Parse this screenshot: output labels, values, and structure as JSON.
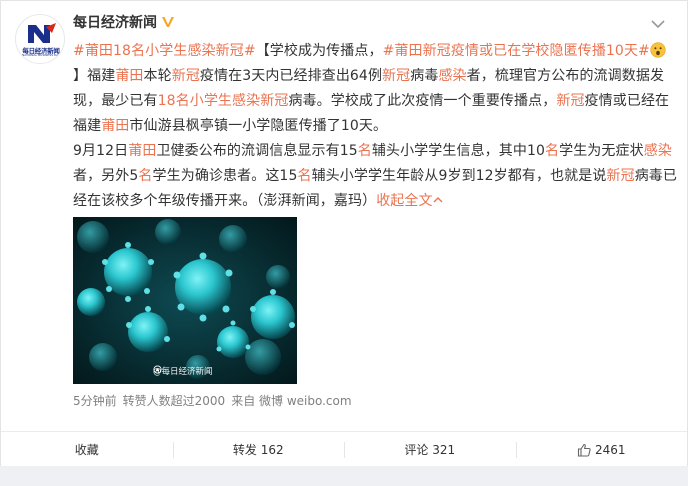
{
  "account": {
    "name": "每日经济新闻",
    "avatar_caption": "每日经济新闻",
    "avatar_sub": "NATIONAL BUSINESS DAILY"
  },
  "post": {
    "lines": [
      [
        {
          "t": "#莆田18名小学生感染新冠#",
          "c": "tag"
        },
        {
          "t": "【学校成为传播点，",
          "c": "grey"
        },
        {
          "t": "#莆田新冠疫情或已在学校隐匿传播10天#",
          "c": "tag"
        },
        {
          "t": "",
          "c": "emoji"
        }
      ],
      [
        {
          "t": "】福建",
          "c": "grey"
        },
        {
          "t": "莆田",
          "c": "hl"
        },
        {
          "t": "本轮",
          "c": "grey"
        },
        {
          "t": "新冠",
          "c": "hl"
        },
        {
          "t": "疫情在3天内已经排查出64例",
          "c": "grey"
        },
        {
          "t": "新冠",
          "c": "hl"
        },
        {
          "t": "病毒",
          "c": "grey"
        },
        {
          "t": "感染",
          "c": "hl"
        },
        {
          "t": "者，梳理官方公布的流调数据发",
          "c": "grey"
        }
      ],
      [
        {
          "t": "现，最少已有",
          "c": "grey"
        },
        {
          "t": "18名小学生感染新冠",
          "c": "hl"
        },
        {
          "t": "病毒。学校成了此次疫情一个重要传播点，",
          "c": "grey"
        },
        {
          "t": "新冠",
          "c": "hl"
        },
        {
          "t": "疫情或已经在",
          "c": "grey"
        }
      ],
      [
        {
          "t": "福建",
          "c": "grey"
        },
        {
          "t": "莆田",
          "c": "hl"
        },
        {
          "t": "市仙游县枫亭镇一小学隐匿传播了10天。",
          "c": "grey"
        }
      ],
      [
        {
          "t": "9月12日",
          "c": "grey"
        },
        {
          "t": "莆田",
          "c": "hl"
        },
        {
          "t": "卫健委公布的流调信息显示有15",
          "c": "grey"
        },
        {
          "t": "名",
          "c": "hl"
        },
        {
          "t": "辅头小学学生信息，其中10",
          "c": "grey"
        },
        {
          "t": "名",
          "c": "hl"
        },
        {
          "t": "学生为无症状",
          "c": "grey"
        },
        {
          "t": "感染",
          "c": "hl"
        }
      ],
      [
        {
          "t": "者，另外5",
          "c": "grey"
        },
        {
          "t": "名",
          "c": "hl"
        },
        {
          "t": "学生为确诊患者。这15",
          "c": "grey"
        },
        {
          "t": "名",
          "c": "hl"
        },
        {
          "t": "辅头小学学生年龄从9岁到12岁都有，也就是说",
          "c": "grey"
        },
        {
          "t": "新冠",
          "c": "hl"
        },
        {
          "t": "病毒已",
          "c": "grey"
        }
      ],
      [
        {
          "t": "经在该校多个年级传播开来。（澎湃新闻，嘉玛）",
          "c": "grey"
        },
        {
          "t": "收起全文",
          "c": "collapse"
        }
      ]
    ],
    "image_watermark": "@每日经济新闻",
    "time": "5分钟前",
    "repost_info": "转赞人数超过2000",
    "source": "来自 微博 weibo.com"
  },
  "actions": {
    "favorite": "收藏",
    "repost": "转发 162",
    "comment": "评论 321",
    "like": "2461"
  },
  "colors": {
    "accent": "#eb7350",
    "verified": "#f6a623",
    "brand_blue": "#1a2f8a",
    "brand_red": "#d7281e"
  },
  "icons": [
    "verified-icon",
    "chevron-down-icon",
    "emoji-icon",
    "chevron-up-icon",
    "like-icon"
  ]
}
